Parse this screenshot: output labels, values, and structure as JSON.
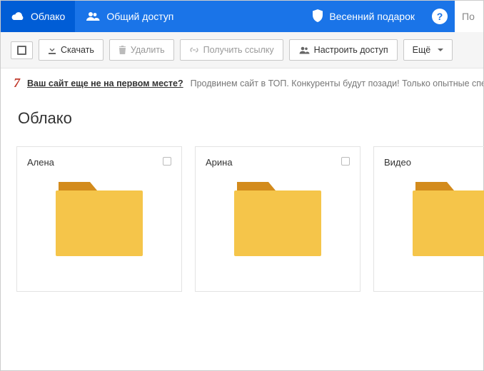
{
  "topnav": {
    "tabs": [
      {
        "label": "Облако",
        "active": true
      },
      {
        "label": "Общий доступ",
        "active": false
      }
    ],
    "gift_label": "Весенний подарок",
    "help_glyph": "?",
    "search_stub": "По"
  },
  "toolbar": {
    "download": "Скачать",
    "delete": "Удалить",
    "getlink": "Получить ссылку",
    "share": "Настроить доступ",
    "more": "Ещё"
  },
  "ad": {
    "icon_text": "7",
    "link": "Ваш сайт еще не на первом месте?",
    "tail": "Продвинем сайт в ТОП. Конкуренты будут позади! Только опытные специали"
  },
  "page_title": "Облако",
  "folders": [
    {
      "name": "Алена"
    },
    {
      "name": "Арина"
    },
    {
      "name": "Видео"
    }
  ]
}
